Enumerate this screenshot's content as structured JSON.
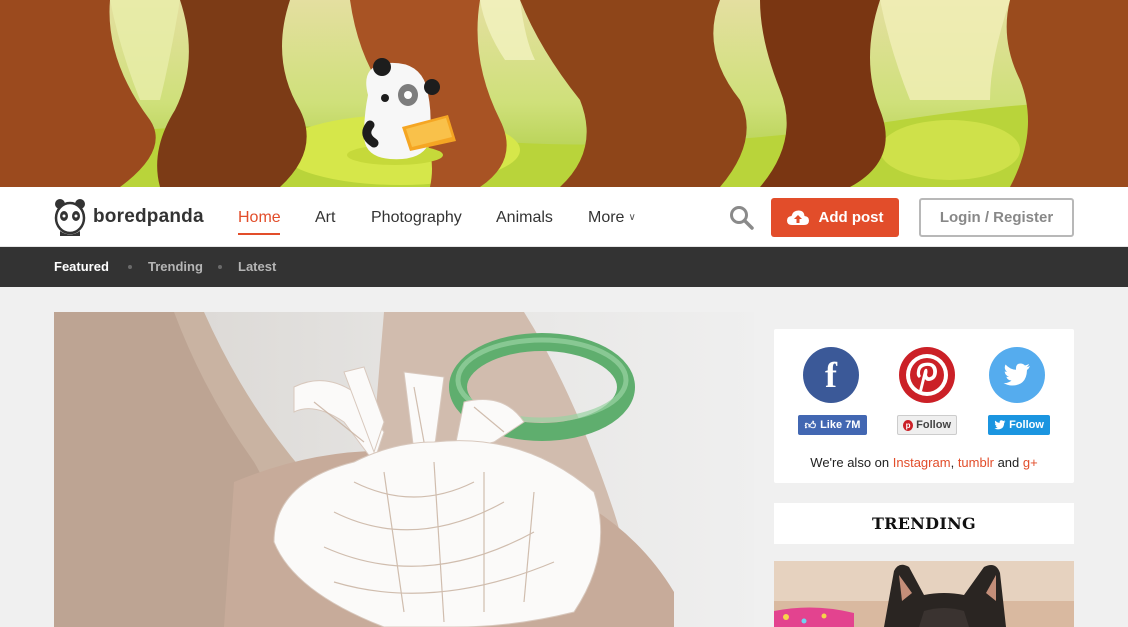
{
  "brand": {
    "name": "boredpanda",
    "accent": "#e24d2a"
  },
  "nav": {
    "items": [
      {
        "label": "Home",
        "active": true
      },
      {
        "label": "Art"
      },
      {
        "label": "Photography"
      },
      {
        "label": "Animals"
      },
      {
        "label": "More"
      }
    ],
    "search_icon": "search-icon",
    "add_post_label": "Add post",
    "login_label": "Login / Register"
  },
  "subnav": {
    "items": [
      {
        "label": "Featured",
        "active": true
      },
      {
        "label": "Trending"
      },
      {
        "label": "Latest"
      }
    ]
  },
  "social": {
    "facebook": {
      "icon": "facebook-icon",
      "button": "Like 7M",
      "color": "#3b5998"
    },
    "pinterest": {
      "icon": "pinterest-icon",
      "button": "Follow",
      "color": "#cb2027"
    },
    "twitter": {
      "icon": "twitter-icon",
      "button": "Follow",
      "color": "#55acee"
    },
    "also_prefix": "We're also on",
    "also_links": [
      "Instagram",
      "tumblr",
      "g+"
    ],
    "also_sep": ",",
    "also_and": "and"
  },
  "trending": {
    "title": "TRENDING"
  }
}
